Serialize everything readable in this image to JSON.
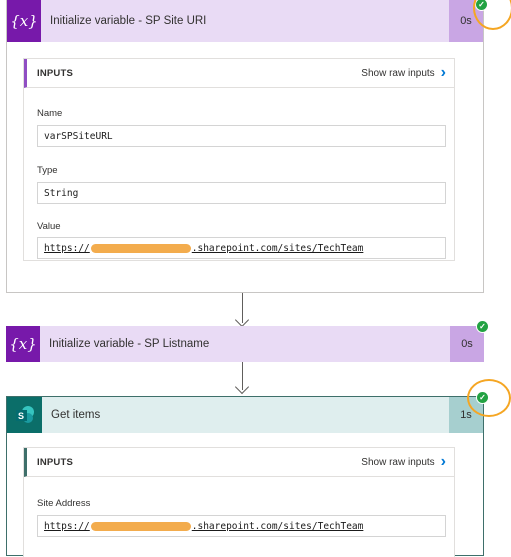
{
  "steps": [
    {
      "title": "Initialize variable - SP Site URI",
      "duration": "0s",
      "inputs": {
        "header": "INPUTS",
        "raw_link": "Show raw inputs",
        "fields": [
          {
            "label": "Name",
            "value": "varSPSiteURL"
          },
          {
            "label": "Type",
            "value": "String"
          },
          {
            "label": "Value",
            "url_prefix": "https://",
            "url_suffix": ".sharepoint.com/sites/TechTeam"
          }
        ]
      }
    },
    {
      "title": "Initialize variable - SP Listname",
      "duration": "0s"
    },
    {
      "title": "Get items",
      "duration": "1s",
      "inputs": {
        "header": "INPUTS",
        "raw_link": "Show raw inputs",
        "fields": [
          {
            "label": "Site Address",
            "url_prefix": "https://",
            "url_suffix": ".sharepoint.com/sites/TechTeam"
          }
        ]
      }
    }
  ],
  "icons": {
    "variable": "{x}",
    "sharepoint": "S",
    "success": "✓"
  },
  "colors": {
    "variable_accent": "#7719aa",
    "sharepoint_accent": "#0b6e69",
    "success": "#22a242",
    "highlight": "#f5a623",
    "link": "#0078d4"
  }
}
